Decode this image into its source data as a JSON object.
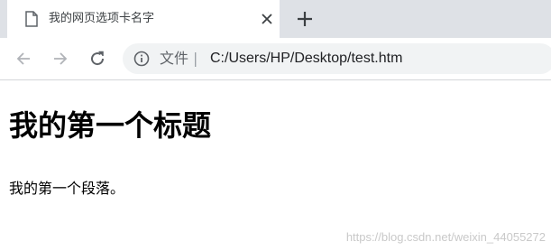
{
  "tab": {
    "title": "我的网页选项卡名字",
    "icon": "document-icon",
    "close_icon": "close-icon"
  },
  "toolbar": {
    "back_icon": "back-arrow-icon",
    "forward_icon": "forward-arrow-icon",
    "reload_icon": "reload-icon",
    "new_tab_icon": "plus-icon"
  },
  "omnibox": {
    "info_icon": "info-icon",
    "scheme_label": "文件",
    "separator": "|",
    "url": "C:/Users/HP/Desktop/test.htm"
  },
  "page": {
    "heading": "我的第一个标题",
    "paragraph": "我的第一个段落。"
  },
  "watermark": "https://blog.csdn.net/weixin_44055272",
  "colors": {
    "tabstrip_bg": "#dee1e6",
    "omnibox_bg": "#f1f3f4",
    "icon_gray": "#5f6368"
  }
}
